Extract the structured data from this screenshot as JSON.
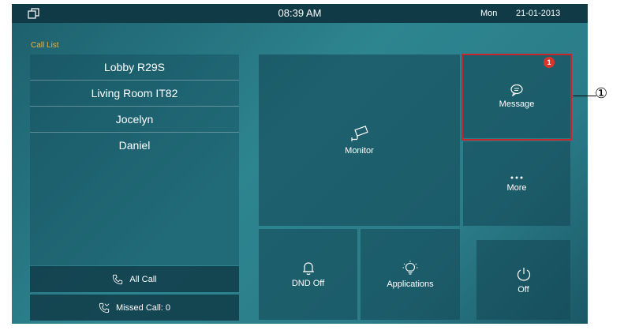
{
  "status_bar": {
    "time": "08:39 AM",
    "day": "Mon",
    "date": "21-01-2013",
    "home_icon": "window-icon"
  },
  "call_list": {
    "label": "Call List",
    "contacts": [
      "Lobby R29S",
      "Living Room IT82",
      "Jocelyn",
      "Daniel"
    ]
  },
  "call_buttons": {
    "all_call_label": "All Call",
    "all_call_icon": "phone-icon",
    "missed_call_label": "Missed Call: 0",
    "missed_call_icon": "missed-call-icon"
  },
  "tiles": {
    "monitor": {
      "label": "Monitor",
      "icon": "camera-icon"
    },
    "message": {
      "label": "Message",
      "icon": "chat-bubble-icon",
      "badge": "1"
    },
    "more": {
      "label": "More",
      "icon": "ellipsis-icon"
    },
    "dnd": {
      "label": "DND Off",
      "icon": "bell-icon"
    },
    "applications": {
      "label": "Applications",
      "icon": "lightbulb-icon"
    },
    "off": {
      "label": "Off",
      "icon": "power-icon"
    }
  },
  "annotation": {
    "marker": "①"
  },
  "colors": {
    "accent_label": "#e3b54a",
    "badge": "#d9342b",
    "highlight_border": "#c9252c",
    "status_bar": "#0f3a46"
  }
}
